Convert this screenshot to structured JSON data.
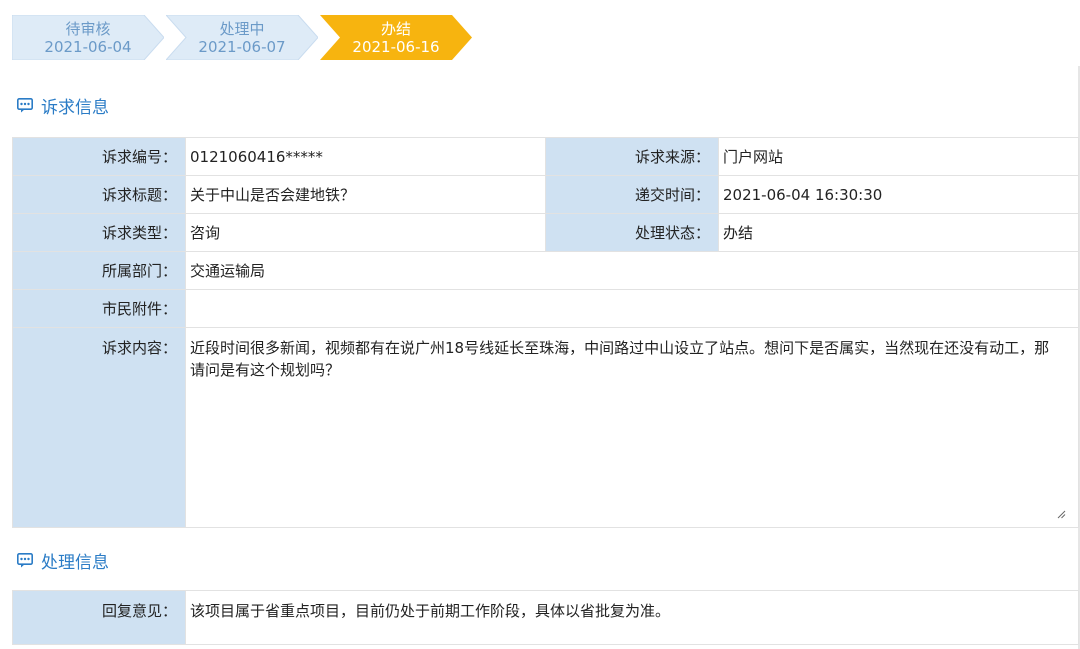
{
  "steps": [
    {
      "label": "待审核",
      "date": "2021-06-04",
      "state": "done"
    },
    {
      "label": "处理中",
      "date": "2021-06-07",
      "state": "done"
    },
    {
      "label": "办结",
      "date": "2021-06-16",
      "state": "current"
    }
  ],
  "colors": {
    "step_inactive_fill": "#deebf7",
    "step_active_fill": "#f7b40f",
    "label_bg": "#cfe1f2",
    "accent": "#2b7cc6"
  },
  "appeal_section": {
    "title": "诉求信息",
    "icon": "message-icon",
    "fields": {
      "number_label": "诉求编号：",
      "number_value": "0121060416*****",
      "source_label": "诉求来源：",
      "source_value": "门户网站",
      "title_label": "诉求标题：",
      "title_value": "关于中山是否会建地铁？",
      "submit_time_label": "递交时间：",
      "submit_time_value": "2021-06-04 16:30:30",
      "type_label": "诉求类型：",
      "type_value": "咨询",
      "status_label": "处理状态：",
      "status_value": "办结",
      "dept_label": "所属部门：",
      "dept_value": "交通运输局",
      "attachment_label": "市民附件：",
      "attachment_value": "",
      "content_label": "诉求内容：",
      "content_value": "近段时间很多新闻，视频都有在说广州18号线延长至珠海，中间路过中山设立了站点。想问下是否属实，当然现在还没有动工，那请问是有这个规划吗？"
    }
  },
  "handling_section": {
    "title": "处理信息",
    "icon": "message-icon",
    "reply_label": "回复意见：",
    "reply_value": "该项目属于省重点项目，目前仍处于前期工作阶段，具体以省批复为准。"
  }
}
